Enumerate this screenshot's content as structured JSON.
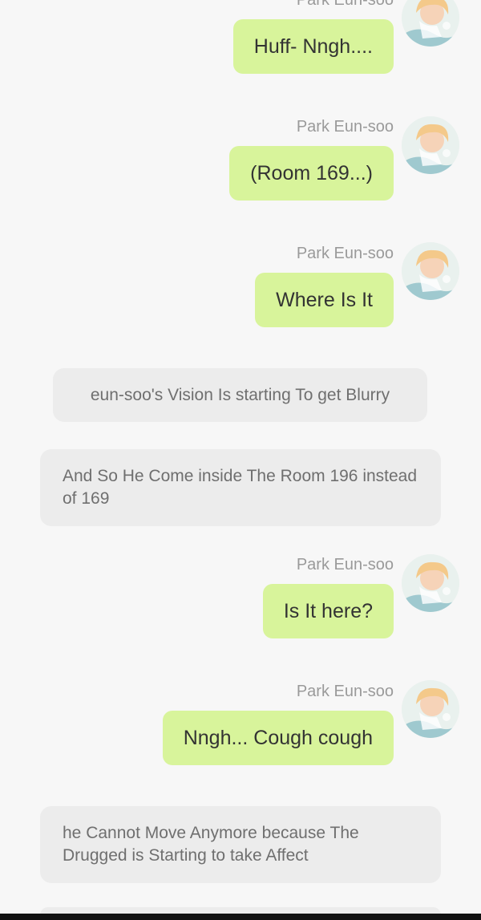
{
  "chat": {
    "speaker": "Park Eun-soo",
    "avatar_icon": "character-portrait-icon",
    "bubble_color": "#d8f49b",
    "narration_color": "#ececec",
    "messages": [
      {
        "type": "user",
        "name": "Park Eun-soo",
        "text": "Huff- Nngh...."
      },
      {
        "type": "user",
        "name": "Park Eun-soo",
        "text": "(Room 169...)"
      },
      {
        "type": "user",
        "name": "Park Eun-soo",
        "text": "Where Is It"
      },
      {
        "type": "narration",
        "text": "eun-soo's Vision Is starting To get Blurry"
      },
      {
        "type": "narration",
        "text": "And So He Come inside The Room 196 instead of 169"
      },
      {
        "type": "user",
        "name": "Park Eun-soo",
        "text": "Is It here?"
      },
      {
        "type": "user",
        "name": "Park Eun-soo",
        "text": "Nngh... Cough cough"
      },
      {
        "type": "narration",
        "text": "he Cannot Move Anymore because The Drugged is Starting to take Affect"
      }
    ]
  }
}
